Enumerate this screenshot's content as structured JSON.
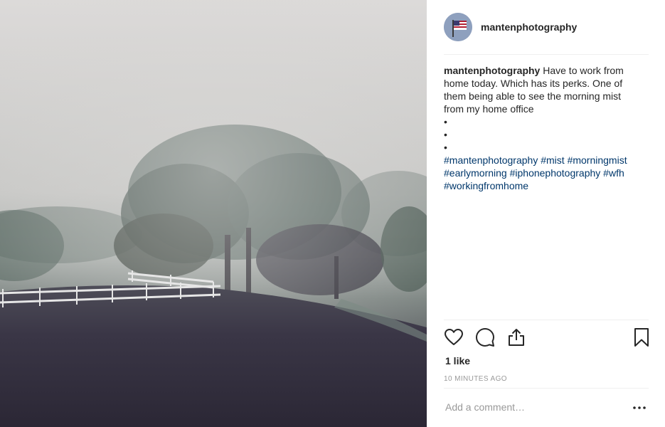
{
  "post": {
    "username": "mantenphotography",
    "avatar_icon": "american-flag-avatar",
    "caption": {
      "username": "mantenphotography",
      "text_line1": "Have to work from",
      "text_line2": "home today. Which has its perks. One of",
      "text_line3": "them being able to see the morning mist",
      "text_line4": "from my home office",
      "bullets": [
        "•",
        "•",
        "•"
      ],
      "hashtags_line1": [
        "#mantenphotography",
        "#mist",
        "#morningmist"
      ],
      "hashtags_line2": [
        "#earlymorning",
        "#iphonephotography",
        "#wfh"
      ],
      "hashtags_line3": [
        "#workingfromhome"
      ]
    },
    "actions": {
      "like_icon": "heart-icon",
      "comment_icon": "speech-bubble-icon",
      "share_icon": "share-icon",
      "save_icon": "bookmark-icon"
    },
    "likes_text": "1 like",
    "timestamp": "10 MINUTES AGO",
    "comment_placeholder": "Add a comment…",
    "more_icon": "ellipsis-icon"
  },
  "colors": {
    "text": "#262626",
    "hashtag": "#00376b",
    "muted": "#999999",
    "divider": "#efefef"
  }
}
